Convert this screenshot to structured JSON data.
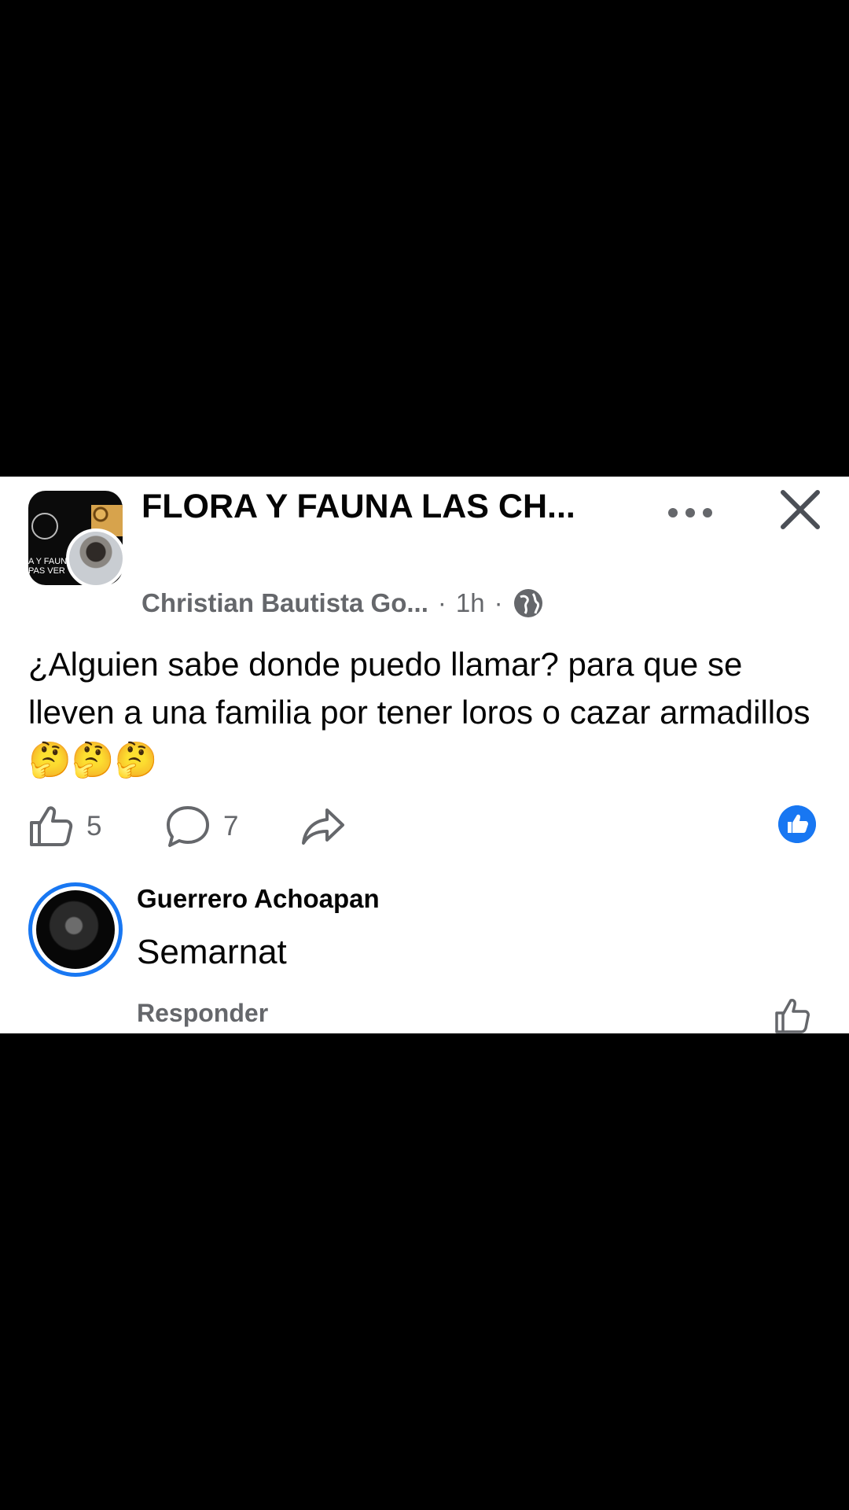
{
  "post": {
    "group_name": "FLORA Y FAUNA  LAS CH...",
    "group_logo_text": "A Y FAUNA\nPAS VER",
    "author": "Christian Bautista Go...",
    "separator": "·",
    "time": "1h",
    "text": "¿Alguien sabe donde puedo llamar? para que se lleven a una familia por tener loros o cazar armadillos",
    "emojis": "🤔🤔🤔",
    "likes": "5",
    "comments": "7"
  },
  "icons": {
    "more": "more-options-icon",
    "close": "close-icon",
    "audience": "globe-icon",
    "like": "thumbs-up-icon",
    "comment": "comment-bubble-icon",
    "share": "share-arrow-icon",
    "reaction": "like-reaction-icon"
  },
  "comment": {
    "author": "Guerrero Achoapan",
    "text": "Semarnat",
    "reply_label": "Responder"
  },
  "colors": {
    "accent": "#1877f2",
    "secondary_text": "#65676b",
    "background": "#000000"
  }
}
